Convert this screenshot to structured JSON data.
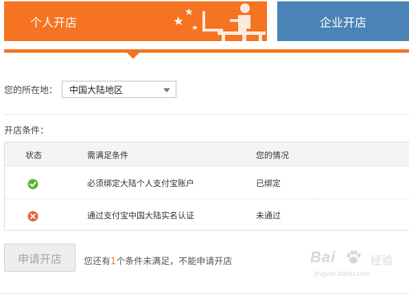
{
  "tabs": {
    "personal": "个人开店",
    "business": "企业开店"
  },
  "location": {
    "label": "您的所在地：",
    "selected": "中国大陆地区"
  },
  "conditions": {
    "label": "开店条件：",
    "headers": [
      "状态",
      "需满足条件",
      "您的情况"
    ],
    "rows": [
      {
        "status_icon": "check-circle-icon",
        "requirement": "必须绑定大陆个人支付宝账户",
        "situation": "已绑定"
      },
      {
        "status_icon": "cross-circle-icon",
        "requirement": "通过支付宝中国大陆实名认证",
        "situation": "未通过"
      }
    ]
  },
  "apply": {
    "button": "申请开店",
    "note_prefix": "您还有",
    "note_count": "1",
    "note_suffix": "个条件未满足，不能申请开店"
  },
  "watermark": {
    "brand": "Bai",
    "brand_cn": "经验",
    "url": "jingyan.baidu.com"
  },
  "colors": {
    "orange": "#f57321",
    "blue": "#4a83b5",
    "success": "#5cb531",
    "error": "#e2652d"
  }
}
